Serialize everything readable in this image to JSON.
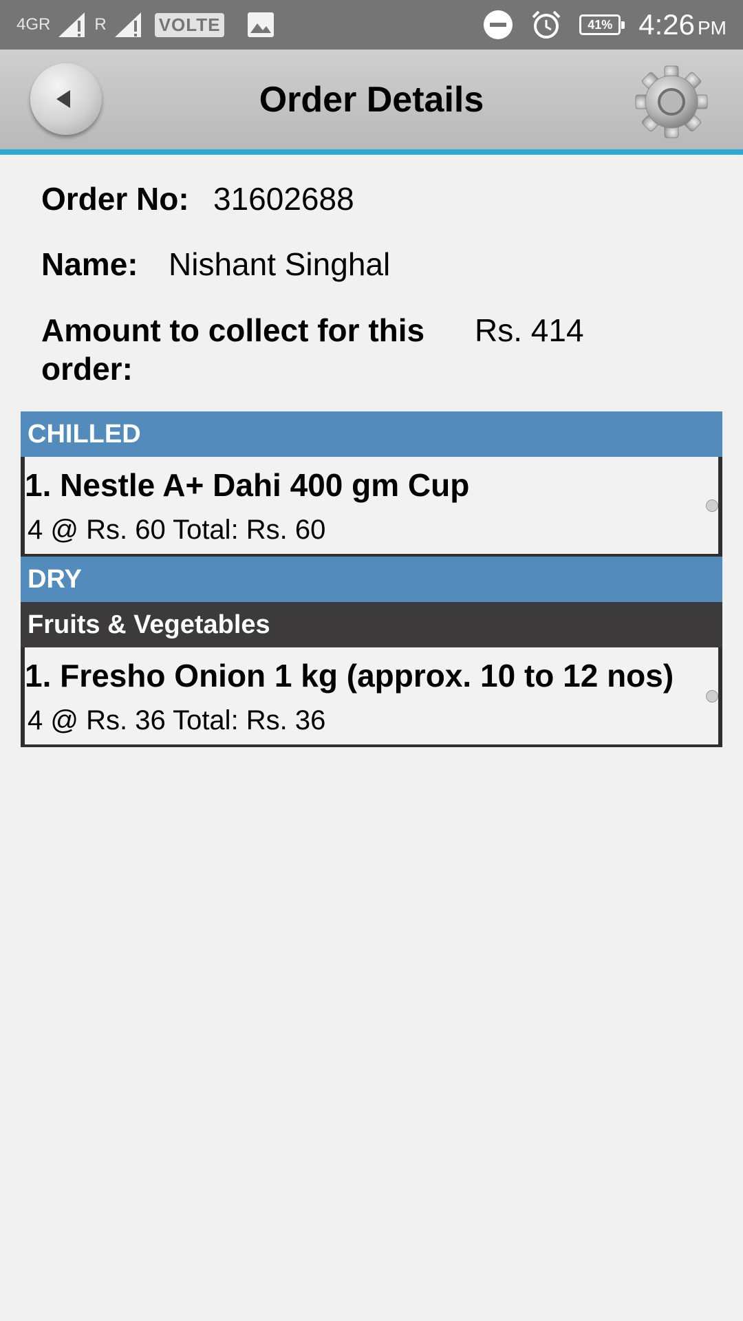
{
  "status_bar": {
    "network_1": "4GR",
    "network_2": "R",
    "volte": "VOLTE",
    "battery": "41%",
    "time": "4:26",
    "ampm": "PM",
    "icons": [
      "signal-icon",
      "image-icon",
      "dnd-icon",
      "alarm-icon",
      "battery-icon"
    ]
  },
  "header": {
    "title": "Order Details",
    "back_icon": "back-arrow-icon",
    "settings_icon": "gear-icon",
    "accent_color": "#2fa9d8"
  },
  "order": {
    "order_no_label": "Order No:",
    "order_no": "31602688",
    "name_label": "Name:",
    "name": "Nishant Singhal",
    "amount_label_line1": "Amount to collect for this",
    "amount_label_line2": "order:",
    "amount": "Rs. 414"
  },
  "sections": [
    {
      "title": "CHILLED",
      "items": [
        {
          "name": "1. Nestle A+ Dahi 400 gm Cup",
          "detail": "4 @ Rs. 60 Total: Rs. 60"
        }
      ]
    },
    {
      "title": "DRY",
      "subsection": "Fruits & Vegetables",
      "items": [
        {
          "name": "1. Fresho Onion 1 kg  (approx. 10 to 12 nos)",
          "detail": "4 @ Rs. 36 Total: Rs. 36"
        }
      ]
    }
  ],
  "colors": {
    "section_header": "#538bbd",
    "subsection_header": "#3c3a3b",
    "background": "#f1f1f1"
  }
}
